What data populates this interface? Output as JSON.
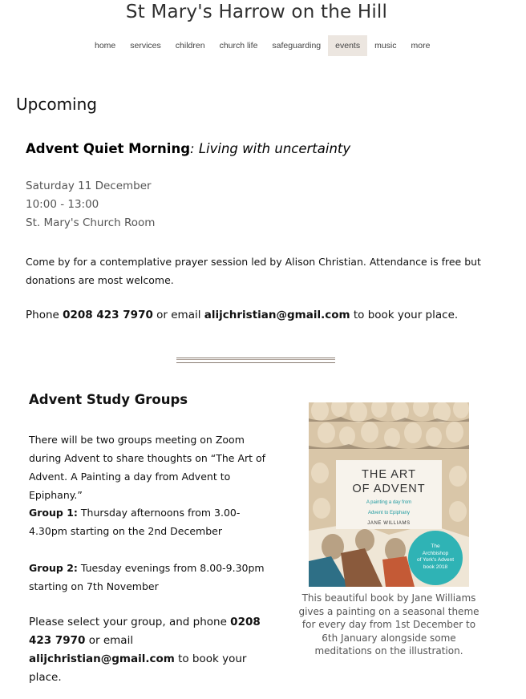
{
  "site": {
    "title": "St Mary's Harrow on the Hill"
  },
  "nav": {
    "items": [
      "home",
      "services",
      "children",
      "church life",
      "safeguarding",
      "events",
      "music",
      "more"
    ],
    "active": "events"
  },
  "section": {
    "heading": "Upcoming"
  },
  "event1": {
    "title": "Advent Quiet Morning",
    "subtitle": ": Living with uncertainty",
    "date": "Saturday 11 December",
    "time": "10:00 - 13:00",
    "location": "St. Mary's Church Room",
    "description": "Come by for a contemplative prayer session led by Alison Christian.  Attendance is free but donations are most welcome.",
    "phone_prefix": "Phone ",
    "phone": "0208 423 7970",
    "email_prefix": " or email ",
    "email": "alijchristian@gmail.com",
    "suffix": " to book your place."
  },
  "event2": {
    "title": "Advent Study Groups",
    "intro": "There will be two groups meeting on Zoom during Advent to share thoughts on “The Art of Advent. A Painting a day from Advent to Epiphany.”",
    "group1_label": "Group 1:",
    "group1_text": " Thursday afternoons from 3.00-4.30pm starting on the 2nd December",
    "group2_label": "Group 2:",
    "group2_text": " Tuesday evenings from 8.00-9.30pm starting on 7th November",
    "select_prefix": "Please select your group, and phone ",
    "phone": "0208 423 7970",
    "email_prefix": " or email ",
    "email": "alijchristian@gmail.com",
    "suffix": " to book your place."
  },
  "book": {
    "title_line1": "THE ART",
    "title_line2": "OF ADVENT",
    "tagline_line1": "A painting a day from",
    "tagline_line2": "Advent to Epiphany",
    "author": "JANE WILLIAMS",
    "badge_line1": "The",
    "badge_line2": "Archbishop",
    "badge_line3": "of York's Advent",
    "badge_line4": "book 2018",
    "caption": "This beautiful book by Jane Williams gives a painting on a seasonal theme for every day from 1st December to 6th January alongside some meditations on the illustration."
  }
}
